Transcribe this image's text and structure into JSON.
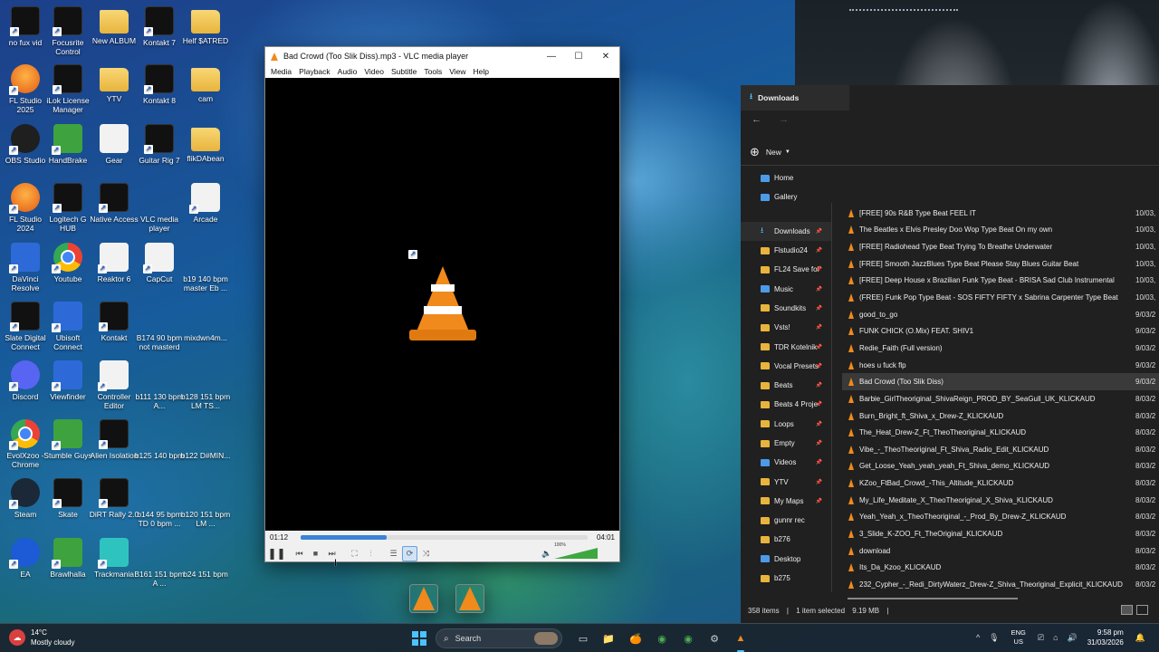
{
  "desktop": {
    "icons": [
      {
        "label": "no fux vid",
        "icon": "video-file-icon"
      },
      {
        "label": "Focusrite Control",
        "icon": "focusrite-icon"
      },
      {
        "label": "New ALBUM",
        "icon": "folder-icon"
      },
      {
        "label": "Kontakt 7",
        "icon": "kontakt-icon"
      },
      {
        "label": "Helf $ATRED",
        "icon": "folder-icon"
      },
      {
        "label": "FL Studio 2025",
        "icon": "fl-studio-icon"
      },
      {
        "label": "iLok License Manager",
        "icon": "ilok-icon"
      },
      {
        "label": "YTV",
        "icon": "folder-icon"
      },
      {
        "label": "Kontakt 8",
        "icon": "kontakt-icon"
      },
      {
        "label": "cam",
        "icon": "folder-icon"
      },
      {
        "label": "OBS Studio",
        "icon": "obs-icon"
      },
      {
        "label": "HandBrake",
        "icon": "handbrake-icon"
      },
      {
        "label": "Gear",
        "icon": "document-icon"
      },
      {
        "label": "Guitar Rig 7",
        "icon": "guitar-rig-icon"
      },
      {
        "label": "flikDAbean",
        "icon": "folder-icon"
      },
      {
        "label": "FL Studio 2024",
        "icon": "fl-studio-icon"
      },
      {
        "label": "Logitech G HUB",
        "icon": "logitech-icon"
      },
      {
        "label": "Native Access",
        "icon": "native-access-icon"
      },
      {
        "label": "VLC media player",
        "icon": "vlc-icon"
      },
      {
        "label": "Arcade",
        "icon": "arcade-icon"
      },
      {
        "label": "DaVinci Resolve",
        "icon": "davinci-icon"
      },
      {
        "label": "Youtube",
        "icon": "chrome-icon"
      },
      {
        "label": "Reaktor 6",
        "icon": "reaktor-icon"
      },
      {
        "label": "CapCut",
        "icon": "capcut-icon"
      },
      {
        "label": "b19 140 bpm master Eb ...",
        "icon": "vlc-file-icon"
      },
      {
        "label": "Slate Digital Connect",
        "icon": "slate-icon"
      },
      {
        "label": "Ubisoft Connect",
        "icon": "ubisoft-icon"
      },
      {
        "label": "Kontakt",
        "icon": "kontakt-icon"
      },
      {
        "label": "B174 90 bpm not masterd",
        "icon": "vlc-file-icon"
      },
      {
        "label": "mixdwn4m...",
        "icon": "vlc-file-icon"
      },
      {
        "label": "Discord",
        "icon": "discord-icon"
      },
      {
        "label": "Viewfinder",
        "icon": "viewfinder-icon"
      },
      {
        "label": "Controller Editor",
        "icon": "controller-icon"
      },
      {
        "label": "b111 130 bpm A...",
        "icon": "vlc-file-icon"
      },
      {
        "label": "b128 151 bpm LM TS...",
        "icon": "vlc-file-icon"
      },
      {
        "label": "EvolXzoo - Chrome",
        "icon": "chrome-icon"
      },
      {
        "label": "Stumble Guys",
        "icon": "stumble-guys-icon"
      },
      {
        "label": "Alien Isolation",
        "icon": "alien-icon"
      },
      {
        "label": "b125 140 bpm",
        "icon": "vlc-file-icon"
      },
      {
        "label": "b122 D#MIN...",
        "icon": "vlc-file-icon"
      },
      {
        "label": "Steam",
        "icon": "steam-icon"
      },
      {
        "label": "Skate",
        "icon": "skate-icon"
      },
      {
        "label": "DiRT Rally 2.0",
        "icon": "dirt-icon"
      },
      {
        "label": "b144 95 bpm TD 0 bpm ...",
        "icon": "vlc-file-icon"
      },
      {
        "label": "b120 151 bpm LM ...",
        "icon": "vlc-file-icon"
      },
      {
        "label": "EA",
        "icon": "ea-icon"
      },
      {
        "label": "Brawlhalla",
        "icon": "brawlhalla-icon"
      },
      {
        "label": "Trackmania",
        "icon": "trackmania-icon"
      },
      {
        "label": "B161 151 bpm A ...",
        "icon": "vlc-file-icon"
      },
      {
        "label": "b24 151 bpm",
        "icon": "vlc-file-icon"
      }
    ]
  },
  "vlc": {
    "title": "Bad Crowd (Too Slik Diss).mp3 - VLC media player",
    "menu": [
      "Media",
      "Playback",
      "Audio",
      "Video",
      "Subtitle",
      "Tools",
      "View",
      "Help"
    ],
    "time_elapsed": "01:12",
    "time_total": "04:01",
    "progress": 0.3,
    "volume_label": "100%",
    "volume": 1.0,
    "accent": "#f08a1c"
  },
  "explorer": {
    "tab_title": "Downloads",
    "new_label": "New",
    "sidebar": [
      {
        "label": "Home",
        "icon": "home-icon"
      },
      {
        "label": "Gallery",
        "icon": "gallery-icon"
      },
      {
        "label": "Downloads",
        "icon": "download-icon",
        "pinned": true,
        "selected": true
      },
      {
        "label": "Flstudio24",
        "icon": "folder-icon",
        "pinned": true
      },
      {
        "label": "FL24 Save fol",
        "icon": "folder-icon",
        "pinned": true
      },
      {
        "label": "Music",
        "icon": "music-icon",
        "pinned": true
      },
      {
        "label": "Soundkits",
        "icon": "folder-icon",
        "pinned": true
      },
      {
        "label": "Vsts!",
        "icon": "folder-icon",
        "pinned": true
      },
      {
        "label": "TDR Kotelnik",
        "icon": "folder-icon",
        "pinned": true
      },
      {
        "label": "Vocal Presets",
        "icon": "folder-icon",
        "pinned": true
      },
      {
        "label": "Beats",
        "icon": "folder-icon",
        "pinned": true
      },
      {
        "label": "Beats 4 Proje",
        "icon": "folder-icon",
        "pinned": true
      },
      {
        "label": "Loops",
        "icon": "folder-icon",
        "pinned": true
      },
      {
        "label": "Empty",
        "icon": "folder-icon",
        "pinned": true
      },
      {
        "label": "Videos",
        "icon": "videos-icon",
        "pinned": true
      },
      {
        "label": "YTV",
        "icon": "folder-icon",
        "pinned": true
      },
      {
        "label": "My Maps",
        "icon": "folder-icon",
        "pinned": true
      },
      {
        "label": "gunnr rec",
        "icon": "folder-icon"
      },
      {
        "label": "b276",
        "icon": "folder-icon"
      },
      {
        "label": "Desktop",
        "icon": "desktop-icon"
      },
      {
        "label": "b275",
        "icon": "folder-icon"
      }
    ],
    "files": [
      {
        "name": "[FREE] 90s R&B Type Beat FEEL IT",
        "date": "10/03,"
      },
      {
        "name": "The Beatles x Elvis Presley Doo Wop Type Beat  On my own",
        "date": "10/03,"
      },
      {
        "name": "[FREE] Radiohead Type Beat  Trying To Breathe Underwater",
        "date": "10/03,"
      },
      {
        "name": "[FREE] Smooth JazzBlues Type Beat  Please Stay  Blues Guitar Beat",
        "date": "10/03,"
      },
      {
        "name": "[FREE] Deep House x Brazilian Funk Type Beat - BRISA  Sad Club Instrumental",
        "date": "10/03,"
      },
      {
        "name": "(FREE) Funk Pop Type Beat - SOS  FIFTY FIFTY x Sabrina Carpenter Type Beat",
        "date": "10/03,"
      },
      {
        "name": "good_to_go",
        "date": "9/03/2"
      },
      {
        "name": "FUNK CHICK (O.Mix) FEAT. SHIV1",
        "date": "9/03/2"
      },
      {
        "name": "Redie_Faith (Full version)",
        "date": "9/03/2"
      },
      {
        "name": "hoes u fuck flp",
        "date": "9/03/2"
      },
      {
        "name": "Bad Crowd (Too Slik Diss)",
        "date": "9/03/2",
        "selected": true
      },
      {
        "name": "Barbie_GirlTheoriginal_ShivaReign_PROD_BY_SeaGull_UK_KLICKAUD",
        "date": "8/03/2"
      },
      {
        "name": "Burn_Bright_ft_Shiva_x_Drew-Z_KLICKAUD",
        "date": "8/03/2"
      },
      {
        "name": "The_Heat_Drew-Z_Ft_TheoTheoriginal_KLICKAUD",
        "date": "8/03/2"
      },
      {
        "name": "Vibe_-_TheoTheoriginal_Ft_Shiva_Radio_Edit_KLICKAUD",
        "date": "8/03/2"
      },
      {
        "name": "Get_Loose_Yeah_yeah_yeah_Ft_Shiva_demo_KLICKAUD",
        "date": "8/03/2"
      },
      {
        "name": "KZoo_FtBad_Crowd_-This_Altitude_KLICKAUD",
        "date": "8/03/2"
      },
      {
        "name": "My_Life_Meditate_X_TheoTheoriginal_X_Shiva_KLICKAUD",
        "date": "8/03/2"
      },
      {
        "name": "Yeah_Yeah_x_TheoTheoriginal_-_Prod_By_Drew-Z_KLICKAUD",
        "date": "8/03/2"
      },
      {
        "name": "3_Slide_K-ZOO_Ft_TheOriginal_KLICKAUD",
        "date": "8/03/2"
      },
      {
        "name": "download",
        "date": "8/03/2"
      },
      {
        "name": "Its_Da_Kzoo_KLICKAUD",
        "date": "8/03/2"
      },
      {
        "name": "232_Cypher_-_Redi_DirtyWaterz_Drew-Z_Shiva_Theoriginal_Explicit_KLICKAUD",
        "date": "8/03/2"
      }
    ],
    "status_items": "358 items",
    "status_selected": "1 item selected",
    "status_size": "9.19 MB"
  },
  "taskbar": {
    "weather_temp": "14°C",
    "weather_desc": "Mostly cloudy",
    "search_placeholder": "Search",
    "apps": [
      "task-view-icon",
      "file-explorer-icon",
      "fl-studio-icon",
      "chrome-icon",
      "chrome-icon",
      "steam-icon",
      "vlc-icon"
    ],
    "lang": "ENG",
    "region": "US",
    "time": "9:58 pm",
    "date": "31/03/2026"
  }
}
